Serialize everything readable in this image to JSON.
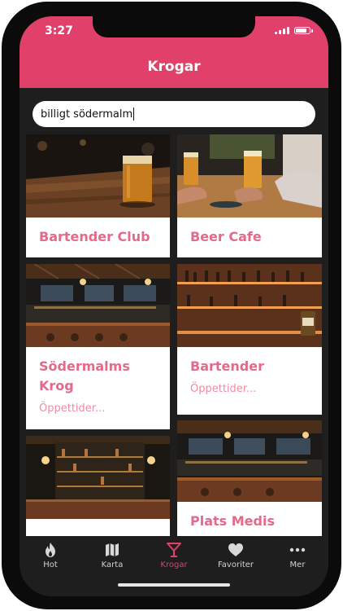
{
  "status": {
    "time": "3:27"
  },
  "header": {
    "title": "Krogar"
  },
  "search": {
    "value": "billigt södermalm"
  },
  "cards": [
    {
      "name": "Bartender Club",
      "subtitle": ""
    },
    {
      "name": "Beer Cafe",
      "subtitle": ""
    },
    {
      "name": "Södermalms Krog",
      "subtitle": "Öppettider..."
    },
    {
      "name": "Bartender",
      "subtitle": "Öppettider..."
    },
    {
      "name": "",
      "subtitle": ""
    },
    {
      "name": "Plats Medis",
      "subtitle": ""
    }
  ],
  "tabs": [
    {
      "label": "Hot",
      "icon": "flame-icon"
    },
    {
      "label": "Karta",
      "icon": "map-icon"
    },
    {
      "label": "Krogar",
      "icon": "cocktail-icon",
      "active": true
    },
    {
      "label": "Favoriter",
      "icon": "heart-icon"
    },
    {
      "label": "Mer",
      "icon": "more-icon"
    }
  ],
  "colors": {
    "accent": "#e0406a",
    "card_text": "#e36a8b",
    "background": "#1e1e1e"
  }
}
